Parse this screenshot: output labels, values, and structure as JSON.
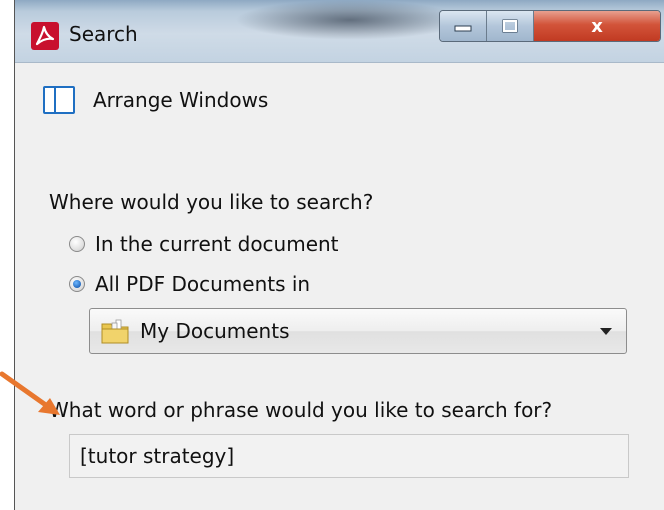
{
  "window": {
    "title": "Search",
    "controls": {
      "minimize": "minimize",
      "maximize": "maximize",
      "close": "x"
    }
  },
  "arrange": {
    "label": "Arrange Windows"
  },
  "search_location": {
    "question": "Where would you like to search?",
    "options": [
      {
        "label": "In the current document",
        "selected": false
      },
      {
        "label": "All PDF Documents in",
        "selected": true
      }
    ],
    "folder": {
      "value": "My Documents"
    }
  },
  "search_phrase": {
    "question": "What word or phrase would you like to search for?",
    "value": "[tutor strategy]"
  },
  "colors": {
    "annotation_arrow": "#e8772e",
    "close_button": "#c9452b",
    "radio_selected": "#1b5fb5"
  }
}
